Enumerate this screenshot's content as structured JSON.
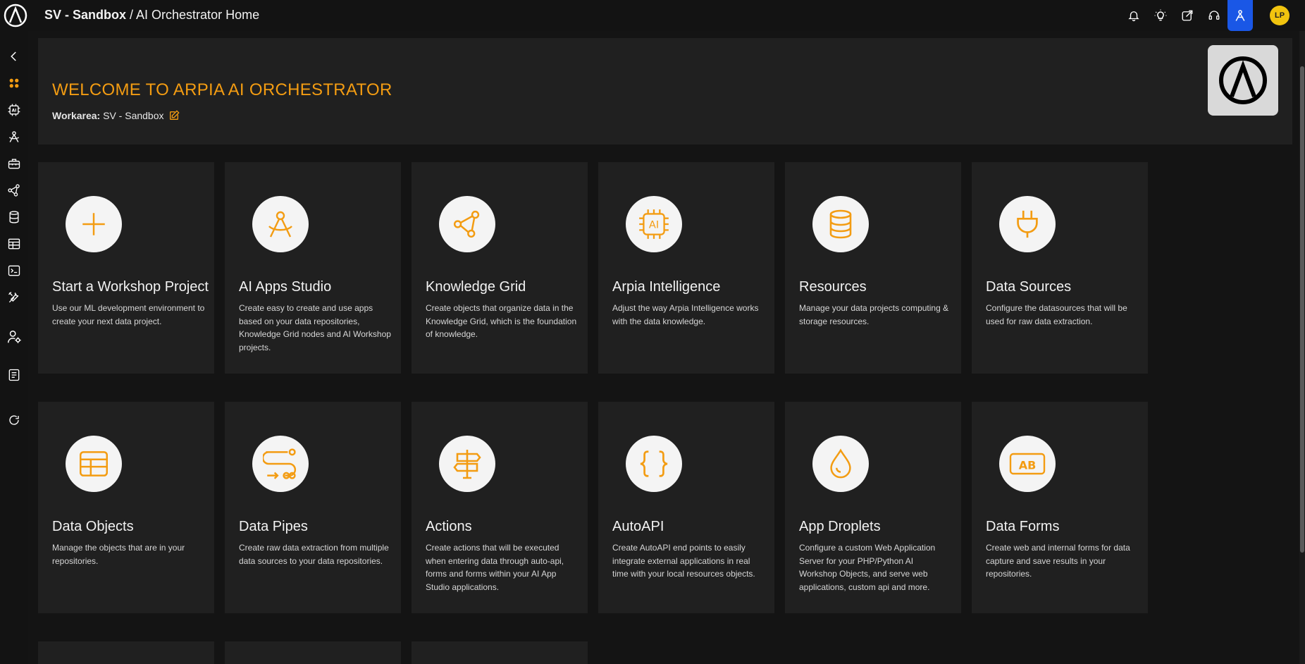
{
  "header": {
    "workspace": "SV - Sandbox",
    "separator": " / ",
    "page": "AI Orchestrator Home",
    "avatar_initials": "LP",
    "icons": [
      "bell-icon",
      "lightbulb-icon",
      "share-icon",
      "support-headset-icon",
      "ai-agent-icon"
    ]
  },
  "sidebar": {
    "icons": [
      "collapse-chevron-icon",
      "home-grid-icon",
      "ai-chip-icon",
      "ai-apps-icon",
      "toolbox-icon",
      "knowledge-graph-icon",
      "database-icon",
      "table-icon",
      "terminal-icon",
      "tools-icon",
      "user-settings-icon",
      "book-icon",
      "refresh-icon"
    ]
  },
  "welcome": {
    "title": "WELCOME TO ARPIA AI ORCHESTRATOR",
    "workarea_label": "Workarea:",
    "workarea_value": "SV - Sandbox"
  },
  "colors": {
    "accent": "#f39c12",
    "background": "#141414",
    "card": "#202020",
    "active_blue": "#1a57e6"
  },
  "cards": [
    {
      "title": "Start a Workshop Project",
      "desc": "Use our ML development environment to create your next data project.",
      "icon": "plus-icon"
    },
    {
      "title": "AI Apps Studio",
      "desc": "Create easy to create and use apps based on your data repositories, Knowledge Grid nodes and AI Workshop projects.",
      "icon": "compass-icon"
    },
    {
      "title": "Knowledge Grid",
      "desc": "Create objects that organize data in the Knowledge Grid, which is the foundation of knowledge.",
      "icon": "graph-nodes-icon"
    },
    {
      "title": "Arpia Intelligence",
      "desc": "Adjust the way Arpia Intelligence works with the data knowledge.",
      "icon": "ai-chip-icon"
    },
    {
      "title": "Resources",
      "desc": "Manage your data projects computing & storage resources.",
      "icon": "database-icon"
    },
    {
      "title": "Data Sources",
      "desc": "Configure the datasources that will be used for raw data extraction.",
      "icon": "plug-icon"
    },
    {
      "title": "Data Objects",
      "desc": "Manage the objects that are in your repositories.",
      "icon": "table-icon"
    },
    {
      "title": "Data Pipes",
      "desc": "Create raw data extraction from multiple data sources to your data repositories.",
      "icon": "pipeline-icon"
    },
    {
      "title": "Actions",
      "desc": "Create actions that will be executed when entering data through auto-api, forms and forms within your AI App Studio applications.",
      "icon": "signpost-icon"
    },
    {
      "title": "AutoAPI",
      "desc": "Create AutoAPI end points to easily integrate external applications in real time with your local resources objects.",
      "icon": "braces-icon"
    },
    {
      "title": "App Droplets",
      "desc": "Configure a custom Web Application Server for your PHP/Python AI Workshop Objects, and serve web applications, custom api and more.",
      "icon": "droplet-icon"
    },
    {
      "title": "Data Forms",
      "desc": "Create web and internal forms for data capture and save results in your repositories.",
      "icon": "form-ab-icon"
    }
  ]
}
